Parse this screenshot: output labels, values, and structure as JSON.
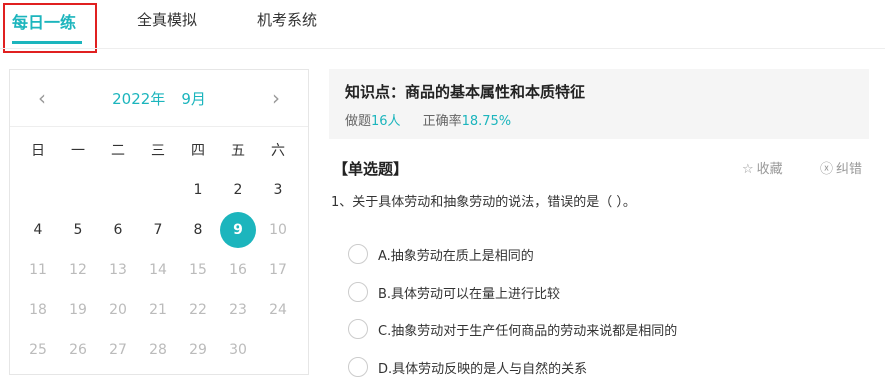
{
  "tabs": [
    {
      "label": "每日一练",
      "active": true
    },
    {
      "label": "全真模拟",
      "active": false
    },
    {
      "label": "机考系统",
      "active": false
    }
  ],
  "calendar": {
    "year": "2022年",
    "month": "9月",
    "weekdays": [
      "日",
      "一",
      "二",
      "三",
      "四",
      "五",
      "六"
    ],
    "rows": [
      [
        "",
        "",
        "",
        "",
        "1",
        "2",
        "3"
      ],
      [
        "4",
        "5",
        "6",
        "7",
        "8",
        "9",
        "10"
      ],
      [
        "11",
        "12",
        "13",
        "14",
        "15",
        "16",
        "17"
      ],
      [
        "18",
        "19",
        "20",
        "21",
        "22",
        "23",
        "24"
      ],
      [
        "25",
        "26",
        "27",
        "28",
        "29",
        "30",
        ""
      ]
    ],
    "selected_day": "9"
  },
  "knowledge": {
    "title": "知识点：商品的基本属性和本质特征",
    "done_label": "做题",
    "done_value": "16人",
    "accuracy_label": "正确率",
    "accuracy_value": "18.75%"
  },
  "question": {
    "type": "【单选题】",
    "favorite": "收藏",
    "report_error": "纠错",
    "text": "1、关于具体劳动和抽象劳动的说法，错误的是（    ）。",
    "options": [
      "A.抽象劳动在质上是相同的",
      "B.具体劳动可以在量上进行比较",
      "C.抽象劳动对于生产任何商品的劳动来说都是相同的",
      "D.具体劳动反映的是人与自然的关系"
    ]
  },
  "colors": {
    "accent": "#1cb5bd",
    "highlight_box": "#e02020"
  }
}
